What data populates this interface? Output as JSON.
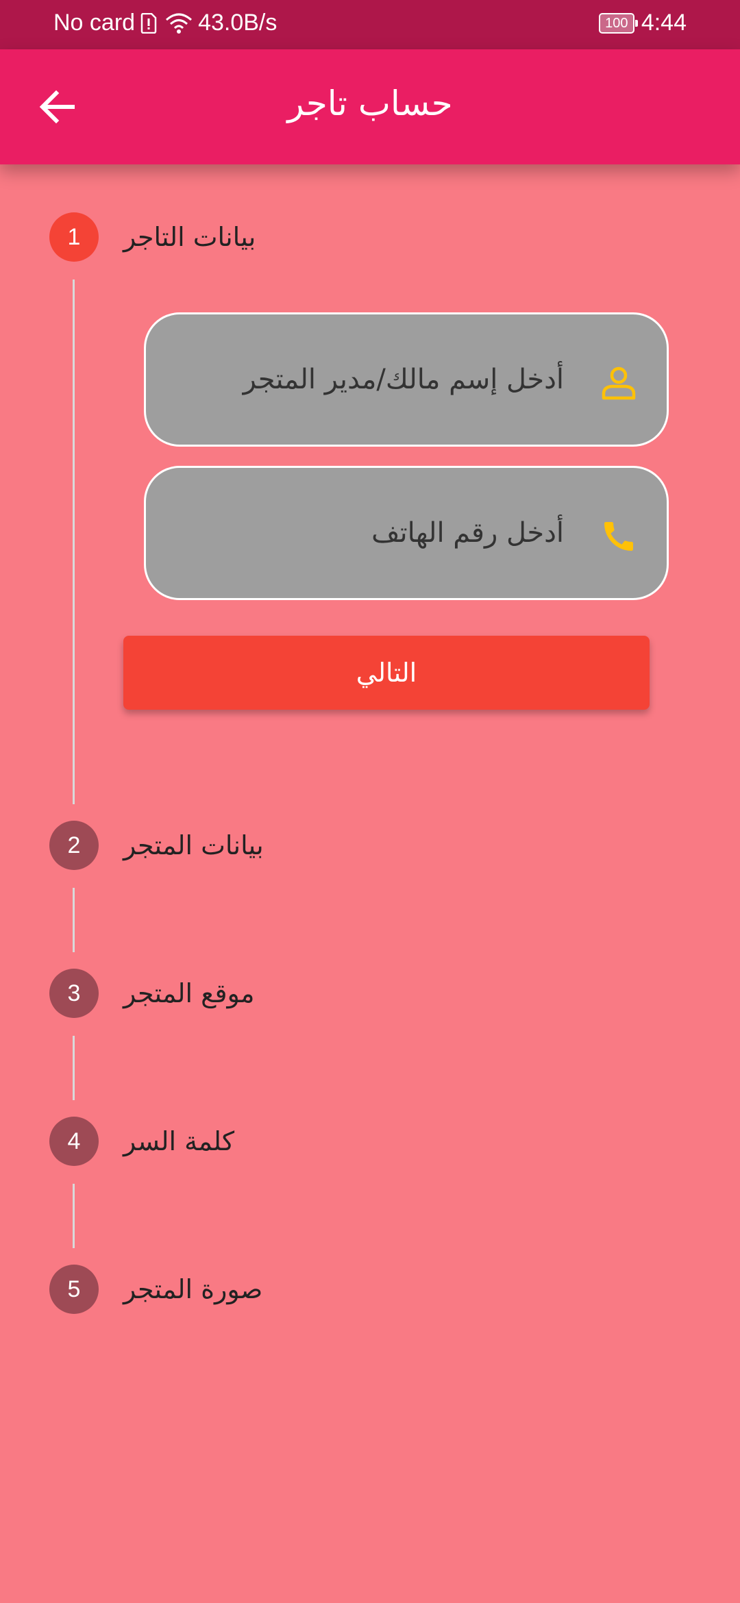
{
  "status_bar": {
    "carrier": "No card",
    "speed": "43.0B/s",
    "battery": "100",
    "time": "4:44"
  },
  "app_bar": {
    "title": "حساب تاجر",
    "back_icon": "arrow-back-icon"
  },
  "steps": [
    {
      "number": "1",
      "title": "بيانات التاجر",
      "state": "active"
    },
    {
      "number": "2",
      "title": "بيانات المتجر",
      "state": "inactive"
    },
    {
      "number": "3",
      "title": "موقع المتجر",
      "state": "inactive"
    },
    {
      "number": "4",
      "title": "كلمة السر",
      "state": "inactive"
    },
    {
      "number": "5",
      "title": "صورة المتجر",
      "state": "inactive"
    }
  ],
  "form": {
    "owner_name": {
      "placeholder": "أدخل إسم مالك/مدير المتجر",
      "icon": "person-icon"
    },
    "phone": {
      "placeholder": "أدخل رقم الهاتف",
      "icon": "phone-icon"
    },
    "next_label": "التالي"
  },
  "colors": {
    "status_bar": "#AE174A",
    "app_bar": "#EA1E63",
    "background": "#F97A84",
    "active_step": "#F44336",
    "inactive_step": "#9E4A55",
    "field_bg": "#9E9E9E",
    "icon_accent": "#FFC107",
    "button": "#F44336"
  }
}
